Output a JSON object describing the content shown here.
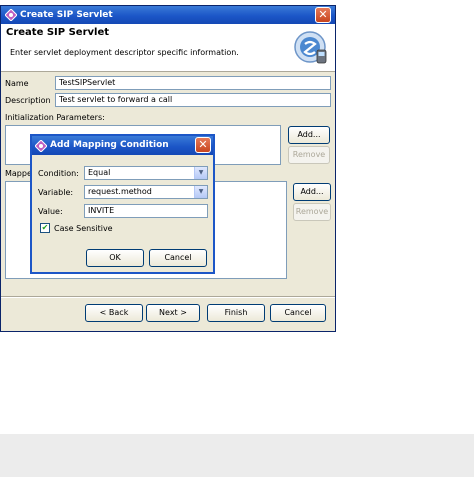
{
  "wizard": {
    "title": "Create SIP Servlet",
    "heading": "Create SIP Servlet",
    "description": "Enter servlet deployment descriptor specific information.",
    "name_label": "Name",
    "name_value": "TestSIPServlet",
    "description_label": "Description",
    "description_value": "Test servlet to forward a call",
    "init_params_label": "Initialization Parameters:",
    "mappings_label": "Mappe",
    "add_label": "Add...",
    "remove_label": "Remove",
    "add2_label": "Add...",
    "remove2_label": "Remove",
    "back_label": "< Back",
    "next_label": "Next >",
    "finish_label": "Finish",
    "cancel_label": "Cancel",
    "close_glyph": "✕"
  },
  "dialog": {
    "title": "Add Mapping Condition",
    "condition_label": "Condition:",
    "condition_value": "Equal",
    "variable_label": "Variable:",
    "variable_value": "request.method",
    "value_label": "Value:",
    "value_value": "INVITE",
    "case_sensitive_label": "Case Sensitive",
    "case_sensitive_checked": true,
    "ok_label": "OK",
    "cancel_label": "Cancel",
    "close_glyph": "✕"
  },
  "colors": {
    "title_bar": "#1c56c7",
    "close_button": "#c7441f",
    "window_bg": "#ece9d8"
  },
  "icons": {
    "window_icon": "diamond-app-icon",
    "logo": "sip-logo-icon",
    "dropdown": "chevron-down-icon",
    "checkmark": "checkmark-icon"
  }
}
